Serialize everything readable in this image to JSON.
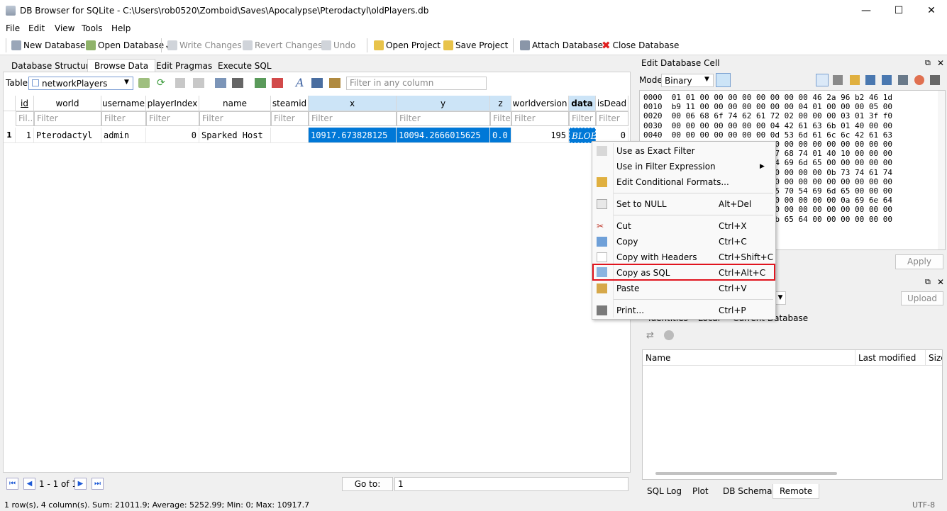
{
  "window": {
    "title": "DB Browser for SQLite - C:\\Users\\rob0520\\Zomboid\\Saves\\Apocalypse\\Pterodactyl\\oldPlayers.db",
    "minimize": "—",
    "maximize": "☐",
    "close": "✕"
  },
  "menu": [
    "File",
    "Edit",
    "View",
    "Tools",
    "Help"
  ],
  "toolbar": {
    "new_db": "New Database",
    "open_db": "Open Database",
    "write": "Write Changes",
    "revert": "Revert Changes",
    "undo": "Undo",
    "open_project": "Open Project",
    "save_project": "Save Project",
    "attach": "Attach Database",
    "close_db": "Close Database"
  },
  "tabs": [
    "Database Structure",
    "Browse Data",
    "Edit Pragmas",
    "Execute SQL"
  ],
  "browse": {
    "table_label": "Table:",
    "table_value": "networkPlayers",
    "filter_placeholder": "Filter in any column",
    "columns": [
      "id",
      "world",
      "username",
      "playerIndex",
      "name",
      "steamid",
      "x",
      "y",
      "z",
      "worldversion",
      "data",
      "isDead"
    ],
    "filter_texts": [
      "Fil...",
      "Filter",
      "Filter",
      "Filter",
      "Filter",
      "Filter",
      "Filter",
      "Filter",
      "Filter",
      "Filter",
      "Filter",
      "Filter"
    ],
    "row_number": "1",
    "row": [
      "1",
      "Pterodactyl",
      "admin",
      "0",
      "Sparked Host",
      "",
      "10917.673828125",
      "10094.2666015625",
      "0.0",
      "195",
      "BLOB",
      "0"
    ]
  },
  "nav": {
    "first": "⏮",
    "prev": "◀",
    "record_info": "1 - 1 of 1",
    "next": "▶",
    "last": "⏭",
    "goto_label": "Go to:",
    "goto_value": "1"
  },
  "status": {
    "summary": "1 row(s), 4 column(s). Sum: 21011.9; Average: 5252.99; Min: 0; Max: 10917.7",
    "encoding": "UTF-8"
  },
  "edit_cell": {
    "title": "Edit Database Cell",
    "mode_label": "Mode:",
    "mode_value": "Binary",
    "hex_lines": [
      "0000  01 01 00 00 00 00 00 00 00 00 46 2a 96 b2 46 1d",
      "0010  b9 11 00 00 00 00 00 00 00 04 01 00 00 00 05 00",
      "0020  00 06 68 6f 74 62 61 72 02 00 00 00 03 01 3f f0",
      "0030  00 00 00 00 00 00 00 04 42 61 63 6b 01 40 00 00",
      "0040  00 00 00 00 00 00 00 0d 53 6d 61 6c 6c 42 61 63",
      "0050  6b 01 40 08 00 00 00 00 00 00 00 00 00 00 00 00",
      "0060  6c 42 65 6c 74 52 69 67 68 74 01 40 10 00 00 00",
      "0070  65 6e 67 74 68 55 70 54 69 6d 65 00 00 00 00 00",
      "0080  00 00 00 00 00 00 00 00 00 00 00 0b 73 74 61 74",
      "0090  4d 6f 64 01 00 00 00 00 00 00 00 00 00 00 00 00",
      "00a0  59 74 6e 65 73 73 73 55 70 54 69 6d 65 00 00 00",
      "00b0  fb c0 00 00 00 00 00 00 00 00 00 00 0a 69 6e 64",
      "00c0  4d 6f 64 01 00 00 00 00 00 00 00 00 00 00 00 00",
      "00d0  01 00 07 53 70 61 72 6b 65 64 00 00 00 00 00 00"
    ],
    "apply": "Apply"
  },
  "remote": {
    "upload": "Upload",
    "tabs": [
      "Identities",
      "Local",
      "Current Database"
    ],
    "col_name": "Name",
    "col_modified": "Last modified",
    "col_size": "Size"
  },
  "bottom_tabs": [
    "SQL Log",
    "Plot",
    "DB Schema",
    "Remote"
  ],
  "context_menu": {
    "items": [
      {
        "label": "Use as Exact Filter",
        "shortcut": ""
      },
      {
        "label": "Use in Filter Expression",
        "shortcut": "▶"
      },
      {
        "label": "Edit Conditional Formats...",
        "shortcut": ""
      },
      {
        "label": "Set to NULL",
        "shortcut": "Alt+Del"
      },
      {
        "label": "Cut",
        "shortcut": "Ctrl+X"
      },
      {
        "label": "Copy",
        "shortcut": "Ctrl+C"
      },
      {
        "label": "Copy with Headers",
        "shortcut": "Ctrl+Shift+C"
      },
      {
        "label": "Copy as SQL",
        "shortcut": "Ctrl+Alt+C"
      },
      {
        "label": "Paste",
        "shortcut": "Ctrl+V"
      },
      {
        "label": "Print...",
        "shortcut": "Ctrl+P"
      }
    ],
    "highlight_color": "#e0141e"
  },
  "colors": {
    "selection": "#0078d7",
    "header_selected": "#cce4f7"
  }
}
